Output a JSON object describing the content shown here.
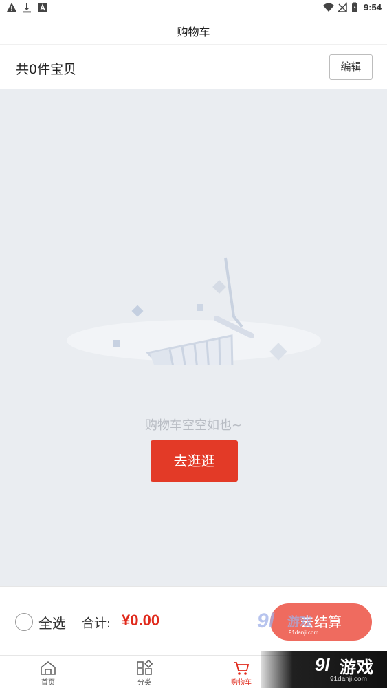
{
  "status_bar": {
    "time": "9:54",
    "left_icons": [
      "warning-icon",
      "download-icon",
      "font-icon"
    ],
    "right_icons": [
      "wifi-icon",
      "no-signal-icon",
      "battery-icon"
    ]
  },
  "title_bar": {
    "title": "购物车"
  },
  "cart_header": {
    "count_text": "共0件宝贝",
    "edit_label": "编辑"
  },
  "empty_state": {
    "message": "购物车空空如也~",
    "button_label": "去逛逛",
    "illustration": "empty-cart-illustration"
  },
  "checkout_bar": {
    "select_all_label": "全选",
    "total_label": "合计:",
    "total_value": "¥0.00",
    "checkout_label": "去结算"
  },
  "tabs": [
    {
      "label": "首页",
      "icon": "home-icon",
      "active": false
    },
    {
      "label": "分类",
      "icon": "category-icon",
      "active": false
    },
    {
      "label": "购物车",
      "icon": "cart-icon",
      "active": true
    }
  ],
  "watermark": {
    "small_logo": "9l",
    "small_text": "游戏",
    "small_url": "91danji.com",
    "big_logo": "9l",
    "big_text": "游戏",
    "big_url": "91danji.com"
  },
  "colors": {
    "accent": "#e33a27",
    "checkout_button": "#ef6b5f",
    "price": "#e02a1c",
    "background": "#eaedf1"
  }
}
